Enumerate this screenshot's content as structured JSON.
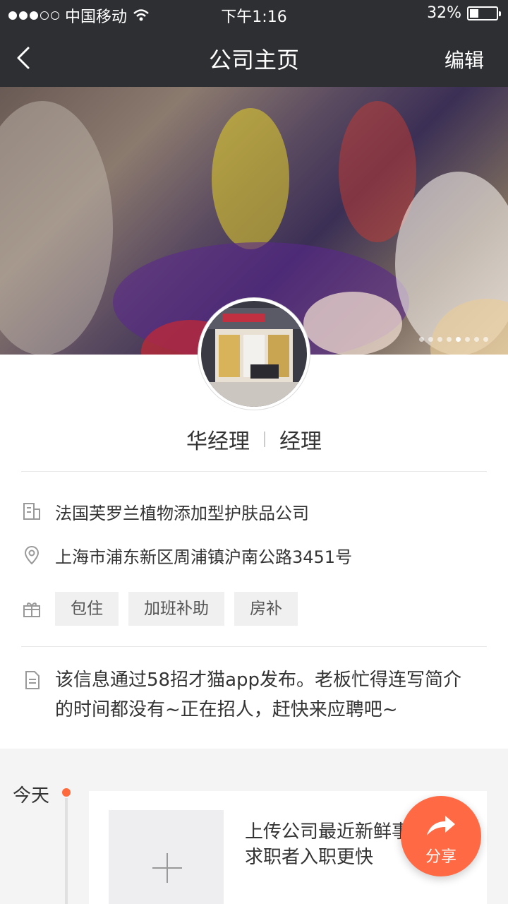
{
  "status_bar": {
    "carrier": "中国移动",
    "time": "下午1:16",
    "battery_text": "32%",
    "battery_level": 0.32
  },
  "nav": {
    "title": "公司主页",
    "edit_label": "编辑"
  },
  "banner": {
    "slide_count": 8,
    "active_slide": 4
  },
  "profile": {
    "name": "华经理",
    "position": "经理"
  },
  "company": {
    "name": "法国芙罗兰植物添加型护肤品公司",
    "address": "上海市浦东新区周浦镇沪南公路3451号",
    "benefits": [
      "包住",
      "加班补助",
      "房补"
    ]
  },
  "intro": {
    "text": "该信息通过58招才猫app发布。老板忙得连写简介的时间都没有~正在招人，赶快来应聘吧~"
  },
  "timeline": {
    "today_label": "今天",
    "upload_prompt": "上传公司最近新鲜事求职者入职更快"
  },
  "share": {
    "label": "分享"
  },
  "colors": {
    "header_bg": "#2e2f33",
    "accent": "#ff6a45"
  }
}
